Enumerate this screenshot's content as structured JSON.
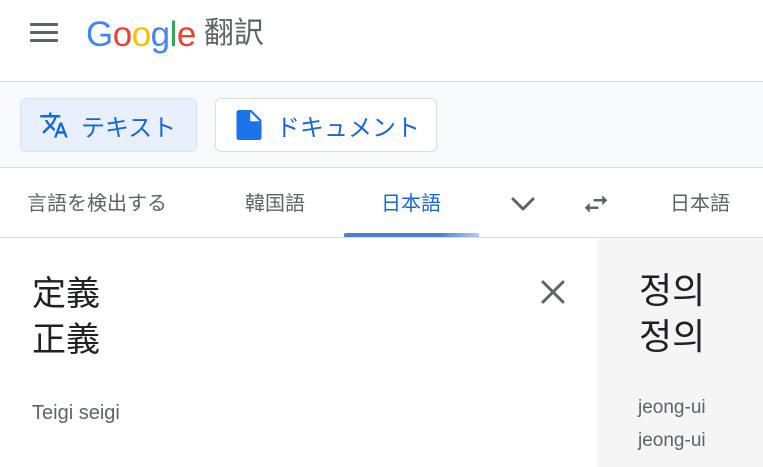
{
  "header": {
    "logo_letters": [
      {
        "char": "G",
        "color": "#4285f4"
      },
      {
        "char": "o",
        "color": "#ea4335"
      },
      {
        "char": "o",
        "color": "#fbbc05"
      },
      {
        "char": "g",
        "color": "#4285f4"
      },
      {
        "char": "l",
        "color": "#34a853"
      },
      {
        "char": "e",
        "color": "#ea4335"
      }
    ],
    "product_name": "翻訳",
    "menu_icon": "hamburger-menu-icon"
  },
  "modes": {
    "text": {
      "label": "テキスト",
      "icon": "translate-icon",
      "selected": true
    },
    "documents": {
      "label": "ドキュメント",
      "icon": "document-icon",
      "selected": false
    }
  },
  "languages": {
    "source": {
      "detect": "言語を検出する",
      "korean": "韓国語",
      "japanese": "日本語",
      "selected": "日本語"
    },
    "more_icon": "chevron-down-icon",
    "swap_icon": "swap-languages-icon",
    "target": {
      "japanese": "日本語"
    }
  },
  "source": {
    "text": "定義\n正義",
    "romanization": "Teigi seigi",
    "clear_icon": "close-icon"
  },
  "target": {
    "text": "정의\n정의",
    "romanization": "jeong-ui\njeong-ui"
  },
  "colors": {
    "accent": "#1967d2",
    "selected_mode_bg": "#e8f0fe",
    "icon_gray": "#5f6368"
  }
}
